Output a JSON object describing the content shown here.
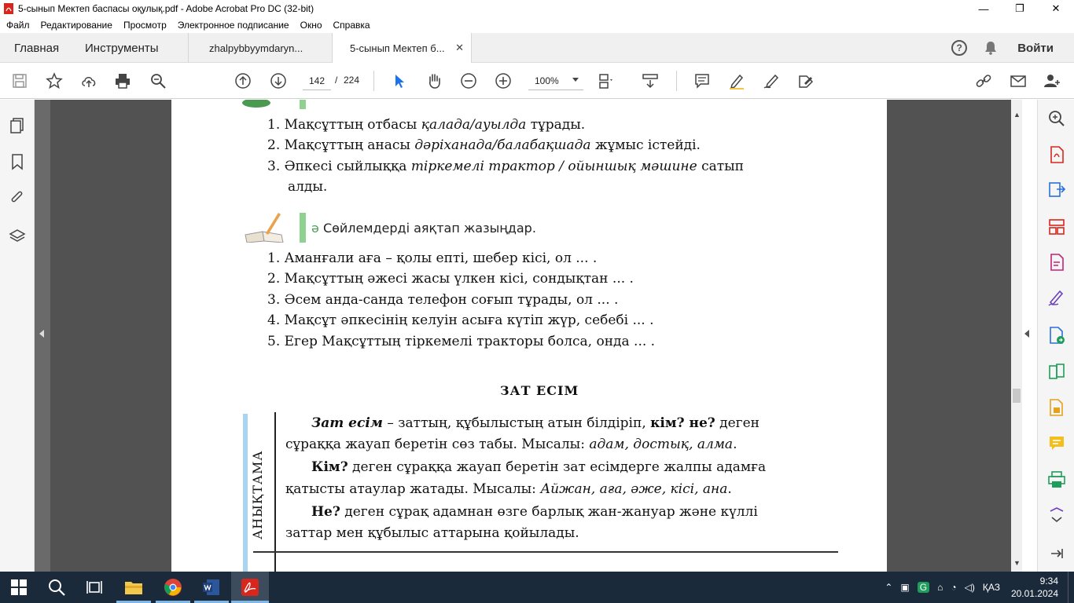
{
  "window": {
    "title": "5-сынып Мектеп баспасы оқулық.pdf - Adobe Acrobat Pro DC (32-bit)",
    "controls": [
      "minimize",
      "restore",
      "close"
    ]
  },
  "menu": [
    "Файл",
    "Редактирование",
    "Просмотр",
    "Электронное подписание",
    "Окно",
    "Справка"
  ],
  "tabs": {
    "home": "Главная",
    "tools": "Инструменты",
    "docs": [
      {
        "label": "zhalpybbyymdaryn..."
      },
      {
        "label": "5-сынып Мектеп б...",
        "close": "✕"
      }
    ],
    "signin": "Войти",
    "help": "?"
  },
  "toolbar": {
    "page_current": "142",
    "page_sep": "/",
    "page_total": "224",
    "zoom": "100%"
  },
  "document": {
    "list1": [
      {
        "n": "1.",
        "a": "Мақсұттың отбасы ",
        "i": "қалада/ауылда",
        "b": " тұрады."
      },
      {
        "n": "2.",
        "a": "Мақсұттың анасы ",
        "i": "дәріханада/балабақшада",
        "b": " жұмыс істейді."
      },
      {
        "n": "3.",
        "a": "Әпкесі сыйлыққа ",
        "i": "тіркемелі трактор / ойыншық мәшине",
        "b": " сатып"
      },
      {
        "n": "",
        "a": "алды.",
        "i": "",
        "b": ""
      }
    ],
    "task_letter": "ә",
    "task_title": "Сөйлемдерді аяқтап жазыңдар.",
    "list2": [
      {
        "n": "1.",
        "t": "Аманғали ағa – қолы епті, шебер кісі, ол ... ."
      },
      {
        "n": "2.",
        "t": "Мақсұттың әжесі жасы үлкен кісі, сондықтан ... ."
      },
      {
        "n": "3.",
        "t": "Әсем анда-санда телефон соғып тұрады, ол ... ."
      },
      {
        "n": "4.",
        "t": "Мақсұт әпкесінің келуін асыға күтіп жүр, себебі ... ."
      },
      {
        "n": "5.",
        "t": "Егер Мақсұттың тіркемелі тракторы болса, онда ... ."
      }
    ],
    "section_title": "ЗАТ ЕСІМ",
    "sidebar_label": "АНЫҚТАМА",
    "def": {
      "p1_term": "Зат есім",
      "p1_rest": " – заттың, құбылыстың атын білдіріп, ",
      "p1_q": "кім? не?",
      "p1_end": " деген",
      "p2_a": "сұраққа жауап беретін сөз табы. Мысалы: ",
      "p2_ex": "адам, достық, алма",
      "p2_end": ".",
      "p3_q": "Кім?",
      "p3_rest": " деген сұраққа жауап беретін зат есімдерге жалпы адамға",
      "p4_a": "қатысты атаулар жатады. Мысалы: ",
      "p4_ex": "Айжан, аға, әже, кісі, ана",
      "p4_end": ".",
      "p5_q": "Не?",
      "p5_rest": " деген сұрақ адамнан өзге барлық жан-жануар және күллі",
      "p6": "заттар мен құбылыс аттарына қойылады."
    }
  },
  "taskbar": {
    "lang": "ҚАЗ",
    "time": "9:34",
    "date": "20.01.2024"
  }
}
